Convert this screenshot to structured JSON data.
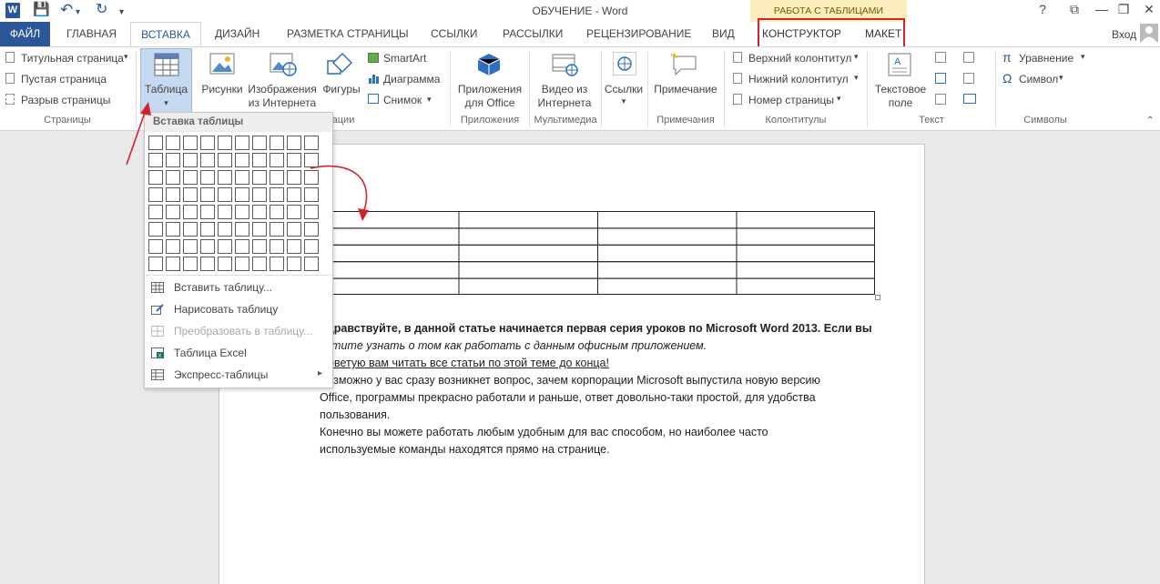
{
  "app": {
    "word_badge": "W",
    "title": "ОБУЧЕНИЕ - Word",
    "context_title": "РАБОТА С ТАБЛИЦАМИ",
    "help": "?",
    "accent": "#2b579a",
    "highlight_red": "#d0232e"
  },
  "qat": {
    "save": "💾",
    "undo": "↶",
    "undo_drop": "▾",
    "redo": "↻",
    "customize": "▾"
  },
  "window": {
    "restore_ribbon": "⧉",
    "minimize": "—",
    "maximize": "❐",
    "close": "✕"
  },
  "tabs": {
    "file": "ФАЙЛ",
    "home": "ГЛАВНАЯ",
    "insert": "ВСТАВКА",
    "design": "ДИЗАЙН",
    "layout": "РАЗМЕТКА СТРАНИЦЫ",
    "refs": "ССЫЛКИ",
    "mailings": "РАССЫЛКИ",
    "review": "РЕЦЕНЗИРОВАНИЕ",
    "view": "ВИД",
    "constructor": "КОНСТРУКТОР",
    "maket": "МАКЕТ"
  },
  "account": {
    "login": "Вход"
  },
  "ribbon": {
    "pages": {
      "title_page": "Титульная страница",
      "blank_page": "Пустая страница",
      "page_break": "Разрыв страницы",
      "group": "Страницы"
    },
    "table": {
      "label": "Таблица",
      "drop": "▾"
    },
    "illustrations": {
      "pictures": "Рисунки",
      "online1": "Изображения",
      "online2": "из Интернета",
      "shapes": "Фигуры",
      "smartart": "SmartArt",
      "chart": "Диаграмма",
      "screenshot": "Снимок",
      "group_partial": "ации"
    },
    "apps": {
      "line1": "Приложения",
      "line2": "для Office",
      "group": "Приложения"
    },
    "media": {
      "line1": "Видео из",
      "line2": "Интернета",
      "group": "Мультимедиа"
    },
    "links": {
      "label": "Ссылки"
    },
    "comments": {
      "label": "Примечание",
      "group": "Примечания"
    },
    "header_footer": {
      "header": "Верхний колонтитул",
      "footer": "Нижний колонтитул",
      "page_number": "Номер страницы",
      "group": "Колонтитулы"
    },
    "text": {
      "textbox1": "Текстовое",
      "textbox2": "поле",
      "group": "Текст"
    },
    "symbols": {
      "equation_icon": "π",
      "equation": "Уравнение",
      "symbol_icon": "Ω",
      "symbol": "Символ",
      "group": "Символы"
    }
  },
  "table_menu": {
    "header": "Вставка таблицы",
    "grid_cols": 10,
    "grid_rows": 8,
    "items": [
      "Вставить таблицу...",
      "Нарисовать таблицу",
      "Преобразовать в таблицу...",
      "Таблица Excel",
      "Экспресс-таблицы"
    ],
    "submenu_arrow": "▸"
  },
  "document": {
    "table_rows": 5,
    "table_cols": 4,
    "line1_bold": "Здравствуйте, в данной статье начинается первая серия уроков по Microsoft Word 2013. Если вы",
    "line2_italic": "хотите узнать о том как работать с данным офисным приложением.",
    "line3_underline": "Советую вам читать все статьи по этой теме до конца!",
    "line4": "Возможно у вас сразу возникнет вопрос, зачем корпорации Microsoft выпустила новую версию",
    "line5": "Office, программы прекрасно работали и раньше, ответ довольно-таки простой, для удобства",
    "line6": "пользования.",
    "line7": "Конечно вы можете работать любым удобным для вас способом, но наиболее часто",
    "line8": "используемые команды находятся прямо на странице."
  }
}
